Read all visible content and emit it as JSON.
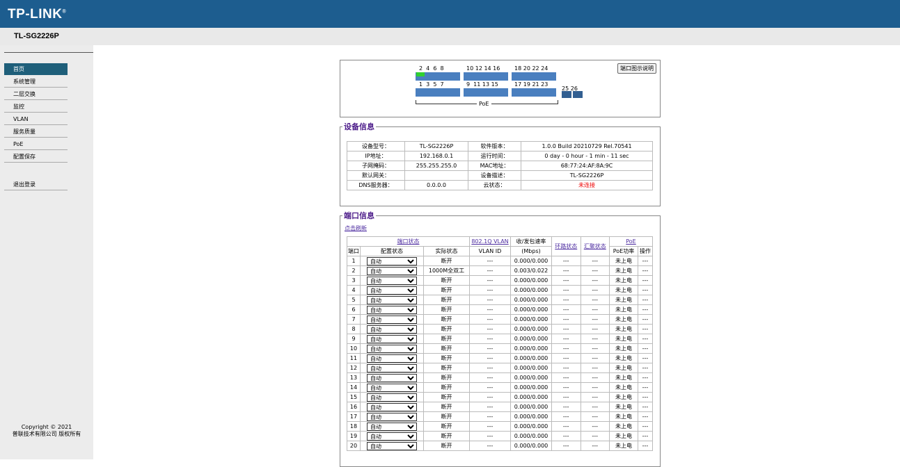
{
  "brand": {
    "logo": "TP-LINK",
    "model": "TL-SG2226P"
  },
  "sidebar": {
    "items": [
      {
        "label": "首页",
        "active": true
      },
      {
        "label": "系统管理"
      },
      {
        "label": "二层交换"
      },
      {
        "label": "监控"
      },
      {
        "label": "VLAN"
      },
      {
        "label": "服务质量"
      },
      {
        "label": "PoE"
      },
      {
        "label": "配置保存"
      }
    ],
    "logout": "退出登录",
    "copyright1": "Copyright © 2021",
    "copyright2": "普联技术有限公司 版权所有"
  },
  "port_panel": {
    "legend_button": "端口图示说明",
    "top_numbers_a": "2  4  6  8",
    "top_numbers_b": "10 12 14 16",
    "top_numbers_c": "18 20 22 24",
    "bottom_numbers_a": "1  3  5  7",
    "bottom_numbers_b": "9  11 13 15",
    "bottom_numbers_c": "17 19 21 23",
    "sfp_numbers": "25 26",
    "poe_label": "PoE"
  },
  "device_info": {
    "title": "设备信息",
    "rows": [
      [
        "设备型号：",
        "TL-SG2226P",
        "软件版本：",
        "1.0.0 Build 20210729 Rel.70541"
      ],
      [
        "IP地址：",
        "192.168.0.1",
        "运行时间：",
        "0 day - 0 hour - 1 min - 11 sec"
      ],
      [
        "子网掩码：",
        "255.255.255.0",
        "MAC地址：",
        "68:77:24:AF:8A:9C"
      ],
      [
        "默认网关：",
        "",
        "设备描述：",
        "TL-SG2226P"
      ],
      [
        "DNS服务器：",
        "0.0.0.0",
        "云状态：",
        "未连接"
      ]
    ]
  },
  "port_info": {
    "title": "端口信息",
    "refresh": "点击刷新",
    "group_headers": {
      "port_status": "端口状态",
      "vlan": "802.1Q VLAN",
      "rate": "收/发包速率",
      "loop": "环路状态",
      "agg": "汇聚状态",
      "poe": "PoE"
    },
    "sub_headers": {
      "port": "端口",
      "config": "配置状态",
      "actual": "实际状态",
      "vlan_id": "VLAN ID",
      "rate_unit": "(Mbps)",
      "poe_power": "PoE功率",
      "op": "操作"
    },
    "select_value": "自动",
    "rows": [
      [
        "1",
        "断开",
        "---",
        "0.000/0.000",
        "---",
        "---",
        "未上电",
        "---"
      ],
      [
        "2",
        "1000M全双工",
        "---",
        "0.003/0.022",
        "---",
        "---",
        "未上电",
        "---"
      ],
      [
        "3",
        "断开",
        "---",
        "0.000/0.000",
        "---",
        "---",
        "未上电",
        "---"
      ],
      [
        "4",
        "断开",
        "---",
        "0.000/0.000",
        "---",
        "---",
        "未上电",
        "---"
      ],
      [
        "5",
        "断开",
        "---",
        "0.000/0.000",
        "---",
        "---",
        "未上电",
        "---"
      ],
      [
        "6",
        "断开",
        "---",
        "0.000/0.000",
        "---",
        "---",
        "未上电",
        "---"
      ],
      [
        "7",
        "断开",
        "---",
        "0.000/0.000",
        "---",
        "---",
        "未上电",
        "---"
      ],
      [
        "8",
        "断开",
        "---",
        "0.000/0.000",
        "---",
        "---",
        "未上电",
        "---"
      ],
      [
        "9",
        "断开",
        "---",
        "0.000/0.000",
        "---",
        "---",
        "未上电",
        "---"
      ],
      [
        "10",
        "断开",
        "---",
        "0.000/0.000",
        "---",
        "---",
        "未上电",
        "---"
      ],
      [
        "11",
        "断开",
        "---",
        "0.000/0.000",
        "---",
        "---",
        "未上电",
        "---"
      ],
      [
        "12",
        "断开",
        "---",
        "0.000/0.000",
        "---",
        "---",
        "未上电",
        "---"
      ],
      [
        "13",
        "断开",
        "---",
        "0.000/0.000",
        "---",
        "---",
        "未上电",
        "---"
      ],
      [
        "14",
        "断开",
        "---",
        "0.000/0.000",
        "---",
        "---",
        "未上电",
        "---"
      ],
      [
        "15",
        "断开",
        "---",
        "0.000/0.000",
        "---",
        "---",
        "未上电",
        "---"
      ],
      [
        "16",
        "断开",
        "---",
        "0.000/0.000",
        "---",
        "---",
        "未上电",
        "---"
      ],
      [
        "17",
        "断开",
        "---",
        "0.000/0.000",
        "---",
        "---",
        "未上电",
        "---"
      ],
      [
        "18",
        "断开",
        "---",
        "0.000/0.000",
        "---",
        "---",
        "未上电",
        "---"
      ],
      [
        "19",
        "断开",
        "---",
        "0.000/0.000",
        "---",
        "---",
        "未上电",
        "---"
      ],
      [
        "20",
        "断开",
        "---",
        "0.000/0.000",
        "---",
        "---",
        "未上电",
        "---"
      ]
    ]
  }
}
